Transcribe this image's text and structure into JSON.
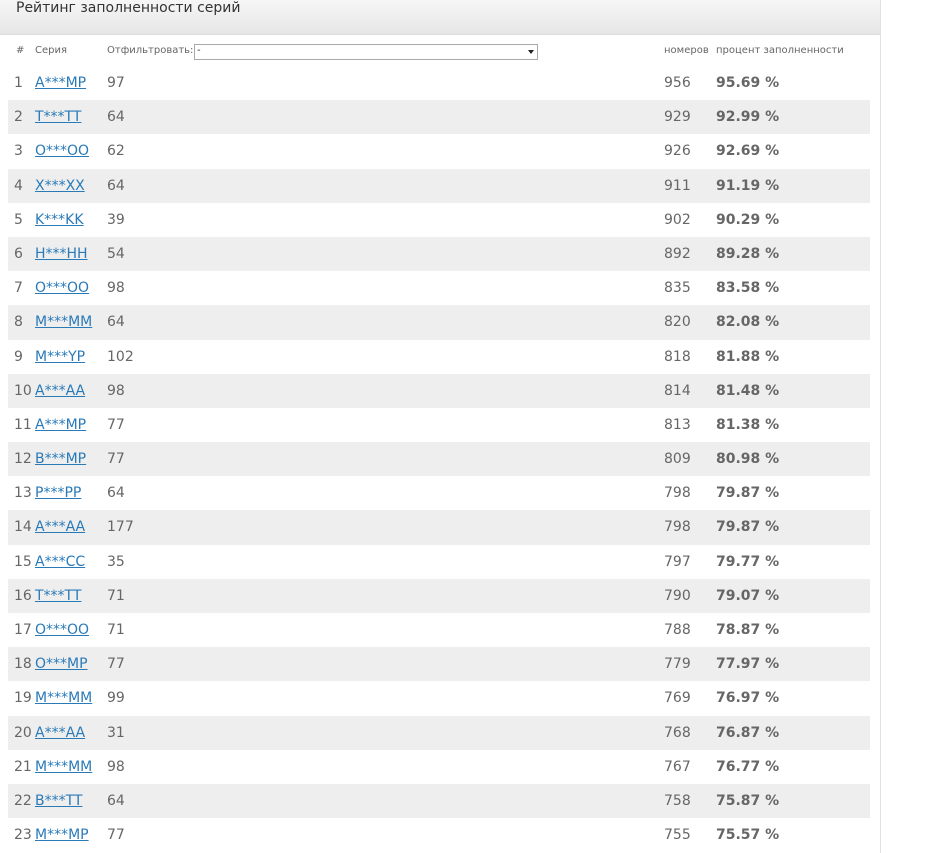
{
  "header": {
    "title": "Рейтинг заполненности серий"
  },
  "columns": {
    "index": "#",
    "series": "Серия",
    "filter_label": "Отфильтровать:",
    "numbers": "номеров",
    "percent": "процент заполненности"
  },
  "filter": {
    "value": "-"
  },
  "rows": [
    {
      "n": "1",
      "series": "A***MP",
      "count": "97",
      "numbers": "956",
      "pct": "95.69 %"
    },
    {
      "n": "2",
      "series": "T***TT",
      "count": "64",
      "numbers": "929",
      "pct": "92.99 %"
    },
    {
      "n": "3",
      "series": "O***OO",
      "count": "62",
      "numbers": "926",
      "pct": "92.69 %"
    },
    {
      "n": "4",
      "series": "X***XX",
      "count": "64",
      "numbers": "911",
      "pct": "91.19 %"
    },
    {
      "n": "5",
      "series": "K***KK",
      "count": "39",
      "numbers": "902",
      "pct": "90.29 %"
    },
    {
      "n": "6",
      "series": "H***HH",
      "count": "54",
      "numbers": "892",
      "pct": "89.28 %"
    },
    {
      "n": "7",
      "series": "O***OO",
      "count": "98",
      "numbers": "835",
      "pct": "83.58 %"
    },
    {
      "n": "8",
      "series": "M***MM",
      "count": "64",
      "numbers": "820",
      "pct": "82.08 %"
    },
    {
      "n": "9",
      "series": "M***YP",
      "count": "102",
      "numbers": "818",
      "pct": "81.88 %"
    },
    {
      "n": "10",
      "series": "A***AA",
      "count": "98",
      "numbers": "814",
      "pct": "81.48 %"
    },
    {
      "n": "11",
      "series": "A***MP",
      "count": "77",
      "numbers": "813",
      "pct": "81.38 %"
    },
    {
      "n": "12",
      "series": "B***MP",
      "count": "77",
      "numbers": "809",
      "pct": "80.98 %"
    },
    {
      "n": "13",
      "series": "P***PP",
      "count": "64",
      "numbers": "798",
      "pct": "79.87 %"
    },
    {
      "n": "14",
      "series": "A***AA",
      "count": "177",
      "numbers": "798",
      "pct": "79.87 %"
    },
    {
      "n": "15",
      "series": "A***CC",
      "count": "35",
      "numbers": "797",
      "pct": "79.77 %"
    },
    {
      "n": "16",
      "series": "T***TT",
      "count": "71",
      "numbers": "790",
      "pct": "79.07 %"
    },
    {
      "n": "17",
      "series": "O***OO",
      "count": "71",
      "numbers": "788",
      "pct": "78.87 %"
    },
    {
      "n": "18",
      "series": "O***MP",
      "count": "77",
      "numbers": "779",
      "pct": "77.97 %"
    },
    {
      "n": "19",
      "series": "M***MM",
      "count": "99",
      "numbers": "769",
      "pct": "76.97 %"
    },
    {
      "n": "20",
      "series": "A***AA",
      "count": "31",
      "numbers": "768",
      "pct": "76.87 %"
    },
    {
      "n": "21",
      "series": "M***MM",
      "count": "98",
      "numbers": "767",
      "pct": "76.77 %"
    },
    {
      "n": "22",
      "series": "B***TT",
      "count": "64",
      "numbers": "758",
      "pct": "75.87 %"
    },
    {
      "n": "23",
      "series": "M***MP",
      "count": "77",
      "numbers": "755",
      "pct": "75.57 %"
    }
  ]
}
